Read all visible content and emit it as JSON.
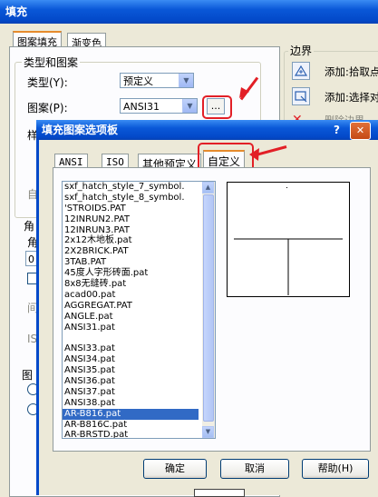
{
  "window": {
    "title": "填充"
  },
  "tabs": [
    {
      "label": "图案填充"
    },
    {
      "label": "渐变色"
    }
  ],
  "type_pattern": {
    "group_label": "类型和图案",
    "type_label": "类型(Y):",
    "type_value": "预定义",
    "pattern_label": "图案(P):",
    "pattern_value": "ANSI31",
    "browse_label": "..."
  },
  "boundary": {
    "group_label": "边界",
    "add_pick_points": "添加:拾取点",
    "add_select_objects": "添加:选择对象",
    "delete_boundary": "删除边界"
  },
  "left_fragments": {
    "sample": "样",
    "custom": "自",
    "angle_group": "角",
    "angle_label": "角",
    "angle_value": "0",
    "spacing": "间",
    "iso": "IS",
    "origin_group": "图"
  },
  "dialog": {
    "title": "填充图案选项板",
    "help_mark": "?",
    "close_mark": "✕",
    "tabs": [
      {
        "label": "ANSI"
      },
      {
        "label": "ISO"
      },
      {
        "label": "其他预定义"
      },
      {
        "label": "自定义"
      }
    ],
    "list_items": [
      "sxf_hatch_style_7_symbol.",
      "sxf_hatch_style_8_symbol.",
      "'STROIDS.PAT",
      "12INRUN2.PAT",
      "12INRUN3.PAT",
      "2x12木地板.pat",
      "2X2BRICK.PAT",
      "3TAB.PAT",
      "45度人字形砖面.pat",
      "8x8无缝砖.pat",
      "acad00.pat",
      "AGGREGAT.PAT",
      "ANGLE.pat",
      "ANSI31.pat",
      "",
      "ANSI33.pat",
      "ANSI34.pat",
      "ANSI35.pat",
      "ANSI36.pat",
      "ANSI37.pat",
      "ANSI38.pat",
      "AR-B816.pat",
      "AR-B816C.pat",
      "AR-BRSTD.pat"
    ],
    "selected_index": 21,
    "ok_label": "确定",
    "cancel_label": "取消",
    "help_label": "帮助(H)"
  },
  "colors": {
    "annotation_red": "#e21f26",
    "title_blue": "#0a58d8",
    "selection_blue": "#316ac5"
  }
}
